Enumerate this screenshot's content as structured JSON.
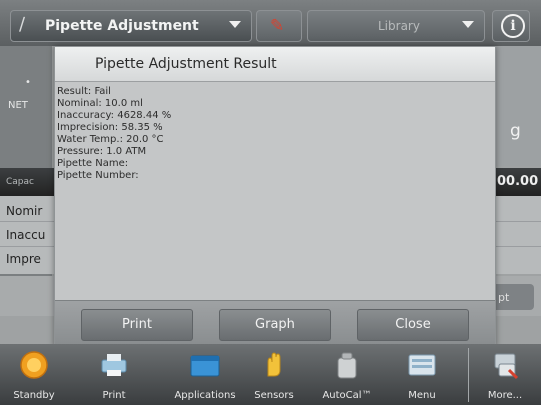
{
  "topbar": {
    "app_label": "Pipette Adjustment",
    "library_label": "Library"
  },
  "background": {
    "net_label": "NET",
    "unit": "g",
    "capacity_label": "Capac",
    "capacity_value": "00.00",
    "rows": [
      "Nomir",
      "Inaccu",
      "Impre"
    ],
    "accept_label": "pt"
  },
  "dialog": {
    "title": "Pipette Adjustment Result",
    "lines": [
      "Result: Fail",
      "Nominal: 10.0 ml",
      "Inaccuracy: 4628.44 %",
      "Imprecision: 58.35 %",
      "Water Temp.: 20.0 °C",
      "Pressure: 1.0 ATM",
      "Pipette Name:",
      "Pipette Number:"
    ],
    "buttons": {
      "print": "Print",
      "graph": "Graph",
      "close": "Close"
    }
  },
  "bottombar": {
    "items": [
      {
        "label": "Standby",
        "icon": "standby-icon"
      },
      {
        "label": "Print",
        "icon": "printer-icon"
      },
      {
        "label": "Applications",
        "icon": "applications-icon"
      },
      {
        "label": "Sensors",
        "icon": "hand-sensor-icon"
      },
      {
        "label": "AutoCal™",
        "icon": "autocal-weight-icon"
      },
      {
        "label": "Menu",
        "icon": "menu-icon"
      },
      {
        "label": "More...",
        "icon": "more-icon"
      }
    ]
  },
  "colors": {
    "accent_red": "#d6422f",
    "standby_orange": "#f0a020"
  }
}
